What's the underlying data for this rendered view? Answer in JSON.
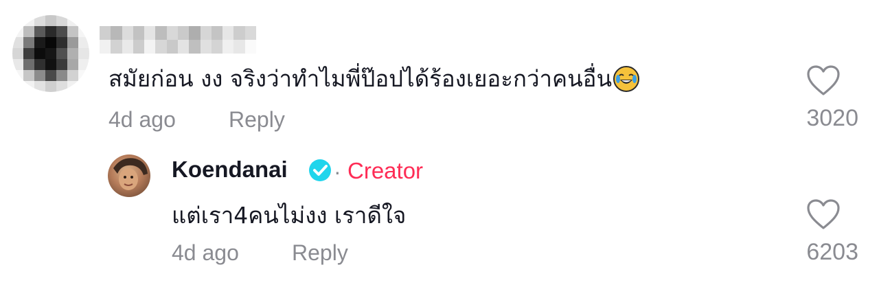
{
  "comment": {
    "text": "สมัยก่อน งง จริงว่าทำไมพี่ป๊อปได้ร้องเยอะกว่าคนอื่น",
    "emoji_icon": "face-with-tears-of-joy-icon",
    "time": "4d ago",
    "reply_label": "Reply",
    "like_count": "3020"
  },
  "reply": {
    "username": "Koendanai",
    "separator": "·",
    "badge_label": "Creator",
    "text": "แต่เรา4คนไม่งง เราดีใจ",
    "time": "4d ago",
    "reply_label": "Reply",
    "like_count": "6203"
  },
  "colors": {
    "creator_accent": "#fe2c55",
    "verified": "#20d5ec",
    "meta_gray": "#8a8b91"
  }
}
